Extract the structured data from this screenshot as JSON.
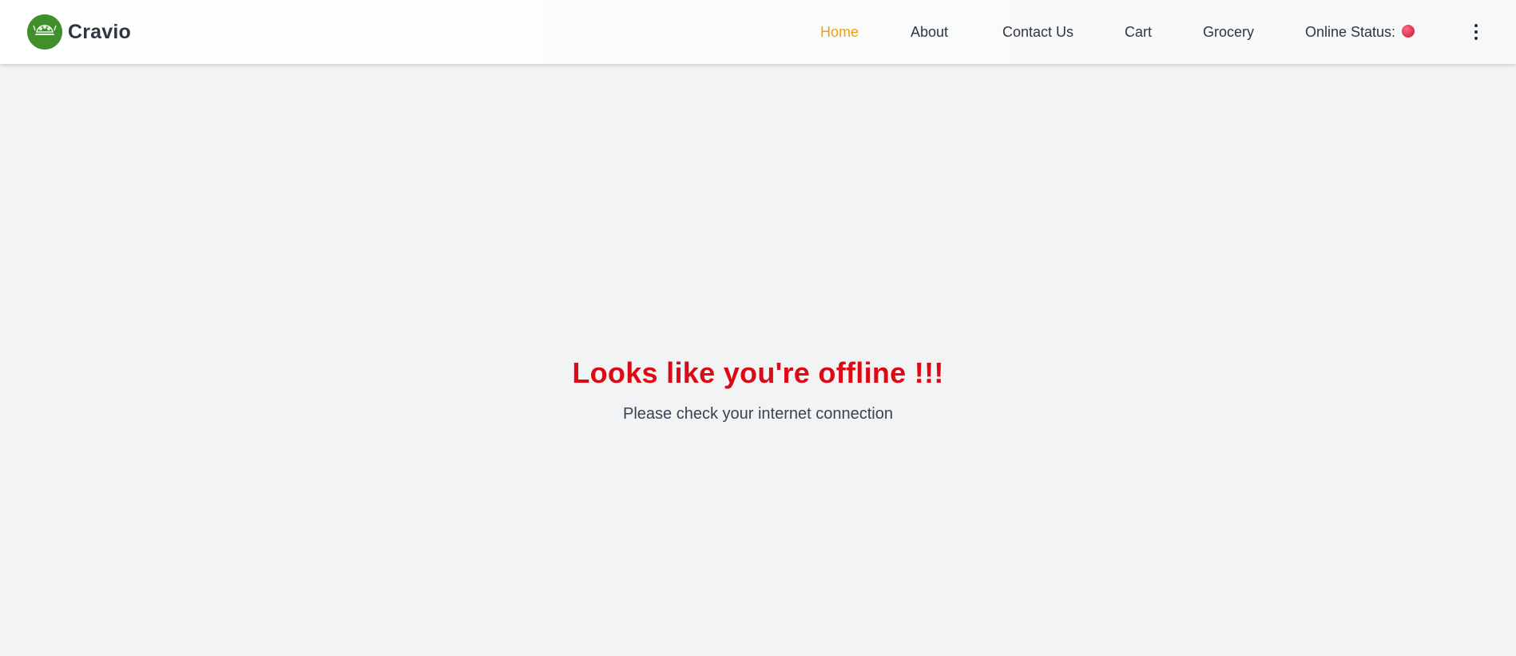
{
  "navbar": {
    "brand": {
      "name": "Cravio",
      "logo_icon": "cravio-logo-icon",
      "logo_color": "#3f8f2b"
    },
    "links": [
      {
        "label": "Home",
        "active": true
      },
      {
        "label": "About",
        "active": false
      },
      {
        "label": "Contact Us",
        "active": false
      },
      {
        "label": "Cart",
        "active": false
      },
      {
        "label": "Grocery",
        "active": false
      }
    ],
    "online_status": {
      "label": "Online Status:",
      "indicator_color": "#e23a55",
      "state": "offline"
    },
    "menu_icon": "kebab-menu-icon",
    "active_color": "#f59e0b"
  },
  "main": {
    "title": "Looks like you're offline !!!",
    "title_color": "#dc0a14",
    "subtitle": "Please check your internet connection"
  }
}
